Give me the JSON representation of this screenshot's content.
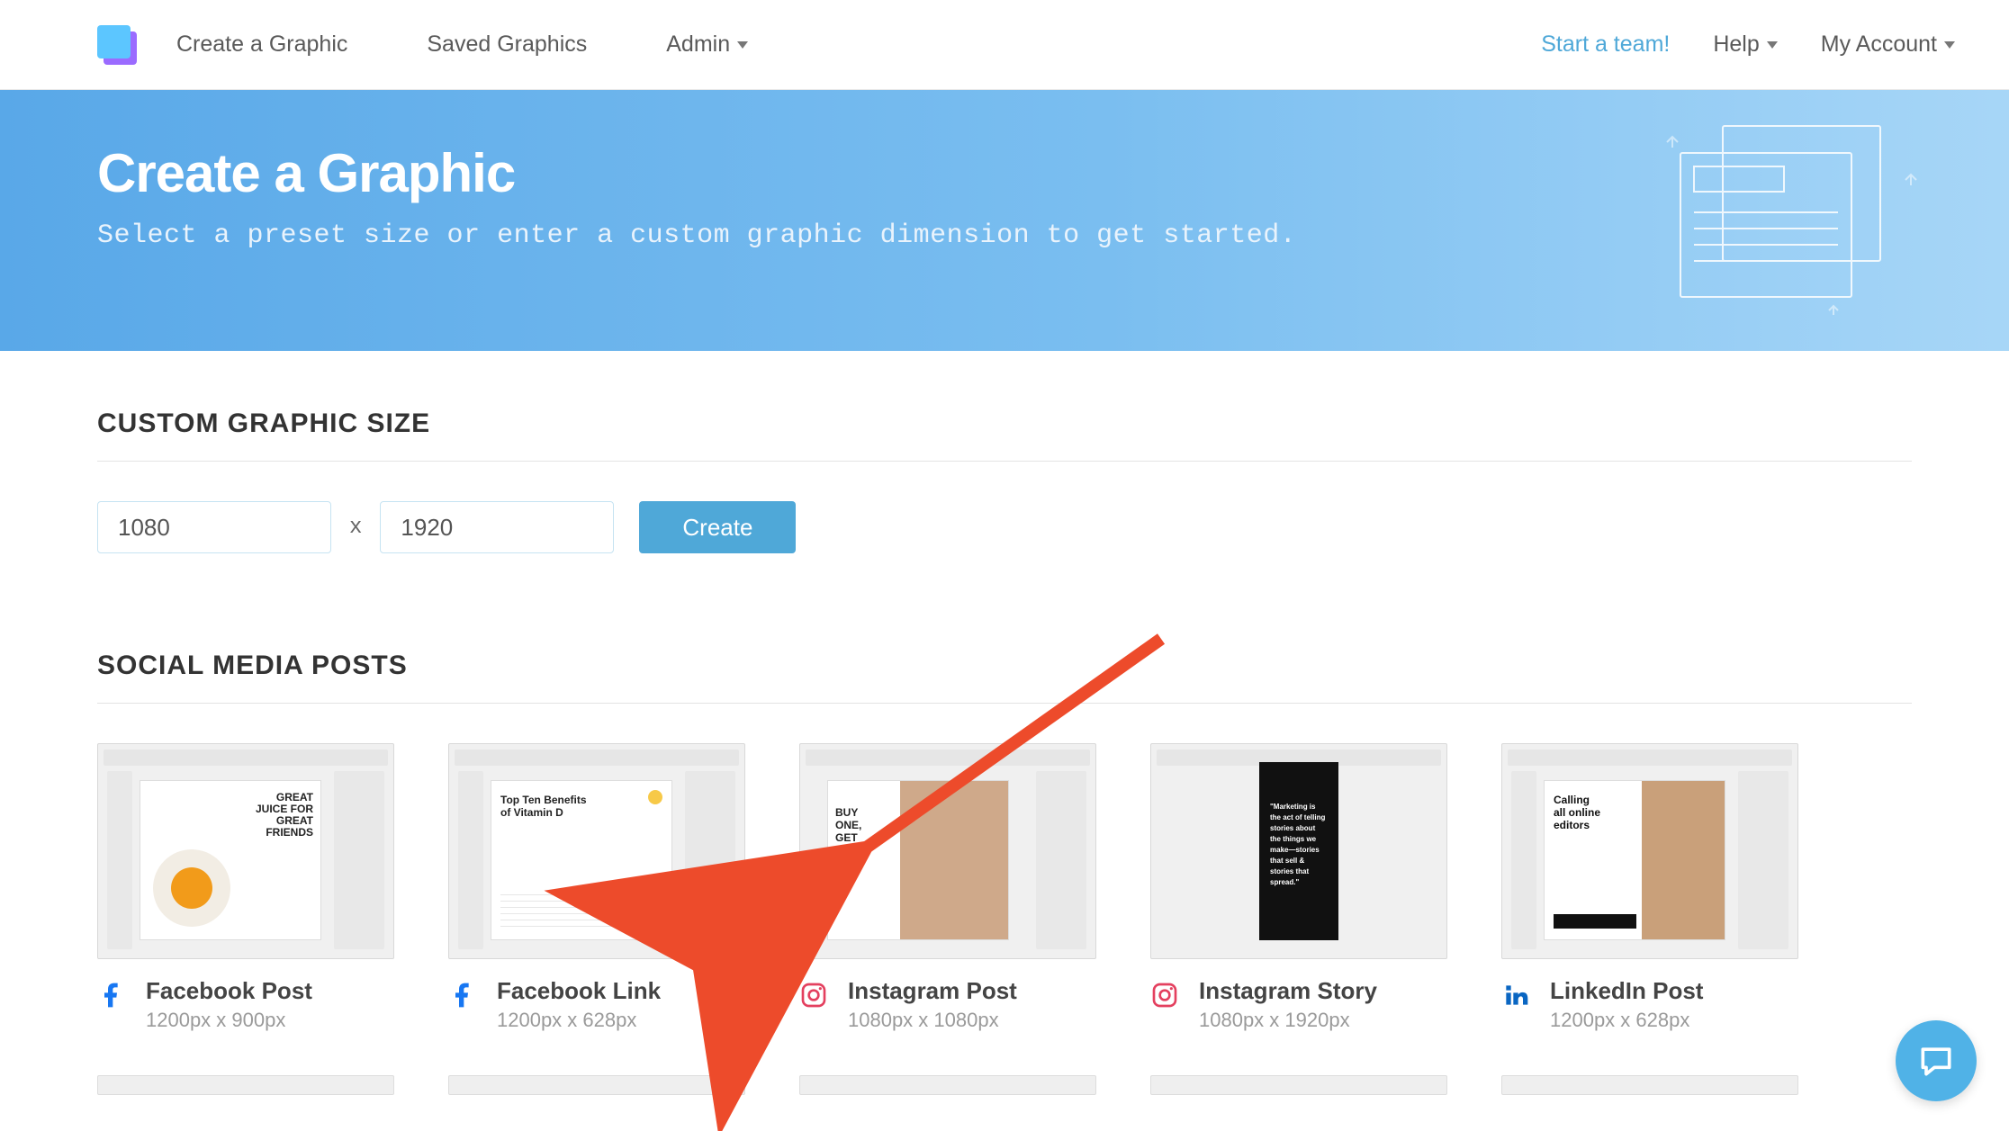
{
  "nav": {
    "links": [
      {
        "label": "Create a Graphic"
      },
      {
        "label": "Saved Graphics"
      },
      {
        "label": "Admin"
      }
    ],
    "start_team": "Start a team!",
    "help": "Help",
    "account": "My Account"
  },
  "hero": {
    "title": "Create a Graphic",
    "subtitle": "Select a preset size or enter a custom graphic dimension to get started."
  },
  "custom": {
    "title": "CUSTOM GRAPHIC SIZE",
    "width": "1080",
    "height": "1920",
    "separator": "x",
    "button": "Create"
  },
  "presets": {
    "title": "SOCIAL MEDIA POSTS",
    "items": [
      {
        "icon": "facebook",
        "name": "Facebook Post",
        "dims": "1200px x 900px"
      },
      {
        "icon": "facebook",
        "name": "Facebook Link",
        "dims": "1200px x 628px"
      },
      {
        "icon": "instagram",
        "name": "Instagram Post",
        "dims": "1080px x 1080px"
      },
      {
        "icon": "instagram",
        "name": "Instagram Story",
        "dims": "1080px x 1920px"
      },
      {
        "icon": "linkedin",
        "name": "LinkedIn Post",
        "dims": "1200px x 628px"
      }
    ]
  },
  "colors": {
    "fb": "#1877f2",
    "ig": "#e4405f",
    "li": "#0a66c2"
  }
}
